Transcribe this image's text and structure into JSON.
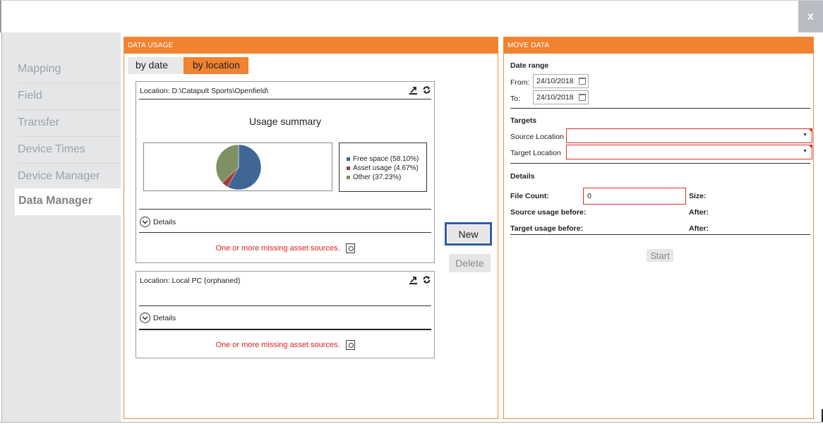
{
  "window": {
    "close_label": "x"
  },
  "sidebar": {
    "items": [
      {
        "label": "Mapping",
        "active": false
      },
      {
        "label": "Field",
        "active": false
      },
      {
        "label": "Transfer",
        "active": false
      },
      {
        "label": "Device Times",
        "active": false
      },
      {
        "label": "Device Manager",
        "active": false
      },
      {
        "label": "Data Manager",
        "active": true
      }
    ]
  },
  "data_usage": {
    "header": "DATA USAGE",
    "tabs": [
      {
        "label": "by date",
        "active": false
      },
      {
        "label": "by location",
        "active": true
      }
    ],
    "locations": [
      {
        "title": "Location: D:\\Catapult Sports\\Openfield\\",
        "summary_title": "Usage summary",
        "legend": [
          {
            "label": "Free space (58.10%)",
            "value": 58.1,
            "color": "#3f6796"
          },
          {
            "label": "Asset usage (4.67%)",
            "value": 4.67,
            "color": "#a33b3f"
          },
          {
            "label": "Other (37.23%)",
            "value": 37.23,
            "color": "#7f9163"
          }
        ],
        "details_label": "Details",
        "missing_text": "One or more missing asset sources."
      },
      {
        "title": "Location: Local PC (orphaned)",
        "details_label": "Details",
        "missing_text": "One or more missing asset sources."
      }
    ],
    "new_button": "New",
    "delete_button": "Delete"
  },
  "move_data": {
    "header": "MOVE DATA",
    "date_range_label": "Date range",
    "from_label": "From:",
    "from_value": "24/10/2018",
    "to_label": "To:",
    "to_value": "24/10/2018",
    "targets_label": "Targets",
    "source_location_label": "Source Location",
    "target_location_label": "Target Location",
    "details_label": "Details",
    "file_count_label": "File Count:",
    "file_count_value": "0",
    "size_label": "Size:",
    "source_usage_label": "Source usage before:",
    "source_after_label": "After:",
    "target_usage_label": "Target usage before:",
    "target_after_label": "After:",
    "start_button": "Start"
  },
  "icons": {
    "close": "close-icon",
    "export": "export-icon",
    "refresh": "refresh-icon",
    "calendar": "calendar-icon",
    "chevron": "chevron-down-circle-icon",
    "document": "document-search-icon"
  }
}
